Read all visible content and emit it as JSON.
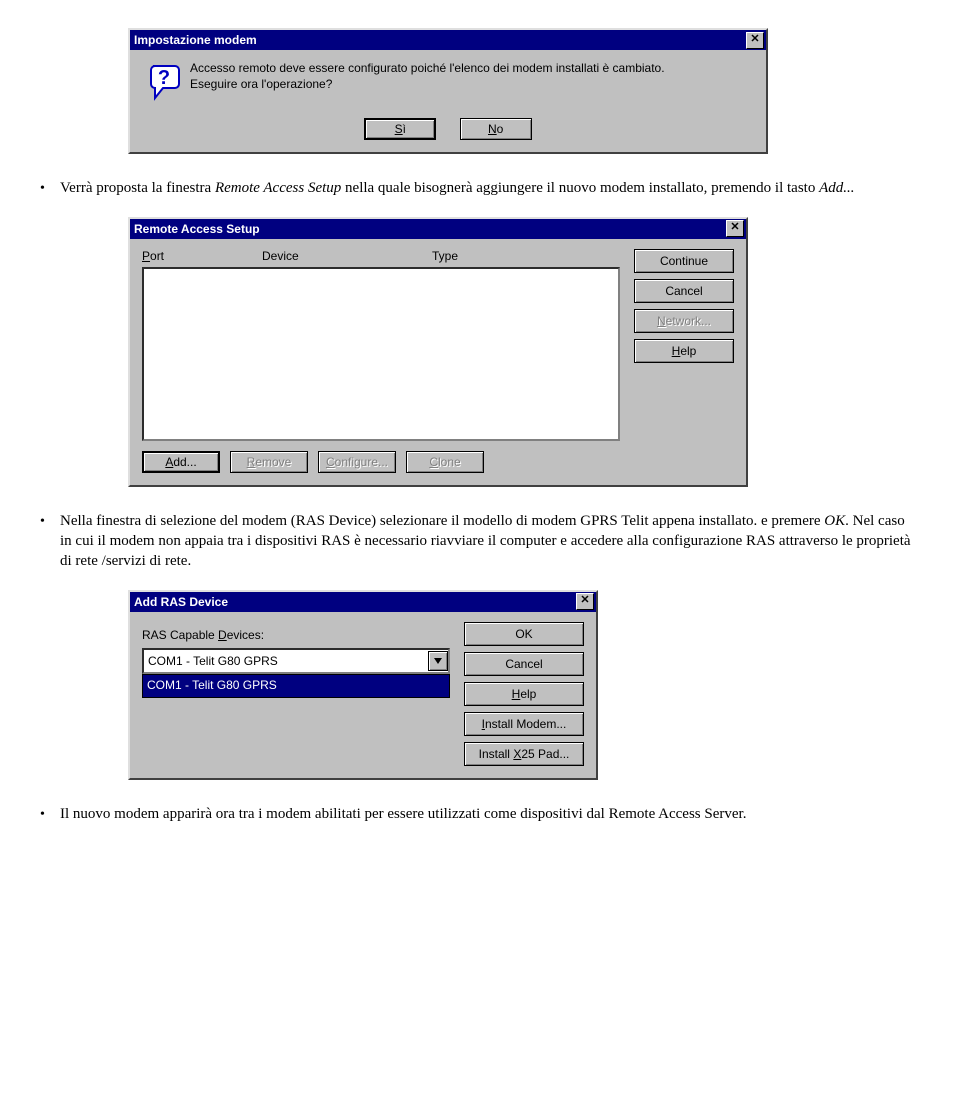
{
  "dialog1": {
    "title": "Impostazione modem",
    "message_line1": "Accesso remoto deve essere configurato poiché l'elenco dei modem installati è cambiato.",
    "message_line2": "Eseguire ora l'operazione?",
    "btn_yes_u": "S",
    "btn_yes_rest": "ì",
    "btn_no_u": "N",
    "btn_no_rest": "o"
  },
  "para1": {
    "pre": "Verrà proposta la finestra ",
    "em1": "Remote Access Setup",
    "mid": "  nella quale bisognerà aggiungere il nuovo modem installato, premendo il tasto ",
    "em2": "Add...",
    "end": ""
  },
  "dialog2": {
    "title": "Remote Access Setup",
    "col_port_u": "P",
    "col_port_rest": "ort",
    "col_device": "Device",
    "col_type": "Type",
    "btn_continue": "Continue",
    "btn_cancel": "Cancel",
    "btn_network_u": "N",
    "btn_network_rest": "etwork...",
    "btn_help_u": "H",
    "btn_help_rest": "elp",
    "btn_add_u": "A",
    "btn_add_rest": "dd...",
    "btn_remove_u": "R",
    "btn_remove_rest": "emove",
    "btn_configure_u": "C",
    "btn_configure_rest": "onfigure...",
    "btn_clone_u": "C",
    "btn_clone_rest": "lone"
  },
  "para2": {
    "pre": "Nella finestra di selezione del modem (RAS Device) selezionare il modello di modem GPRS Telit appena installato. e premere ",
    "em1": "OK",
    "rest": ". Nel caso in cui il modem non appaia tra i dispositivi RAS è necessario riavviare il computer e accedere alla configurazione RAS attraverso le proprietà di rete /servizi di rete."
  },
  "dialog3": {
    "title": "Add RAS Device",
    "label_pre": "RAS Capable ",
    "label_u": "D",
    "label_rest": "evices:",
    "combo_value": "COM1 - Telit G80 GPRS",
    "option_selected": "COM1 - Telit G80 GPRS",
    "btn_ok": "OK",
    "btn_cancel": "Cancel",
    "btn_help_u": "H",
    "btn_help_rest": "elp",
    "btn_install_modem_u": "I",
    "btn_install_modem_rest": "nstall Modem...",
    "btn_install_x25_pre": "Install ",
    "btn_install_x25_u": "X",
    "btn_install_x25_rest": "25 Pad..."
  },
  "para3": {
    "text": "Il nuovo modem apparirà ora tra i modem abilitati per essere utilizzati come dispositivi dal Remote Access Server."
  }
}
